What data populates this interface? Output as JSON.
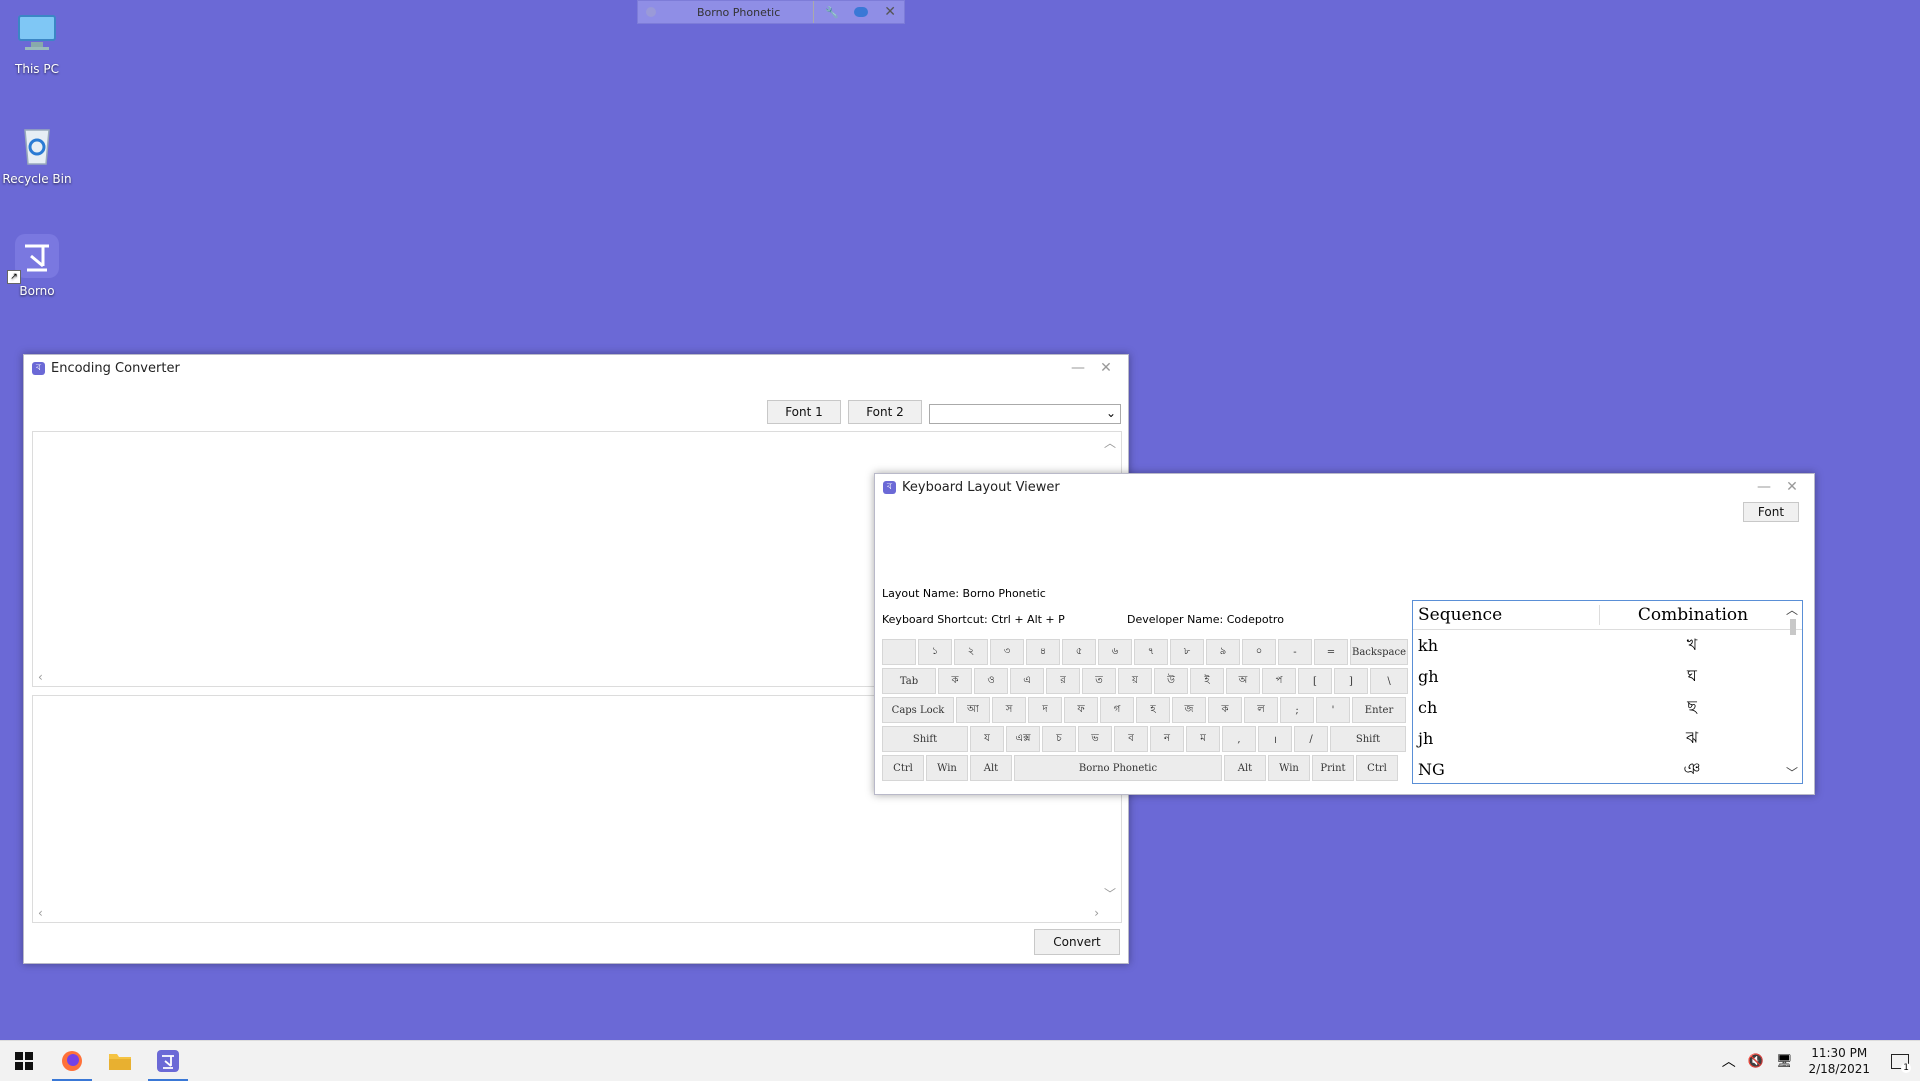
{
  "desktop": {
    "icons": [
      {
        "label": "This PC"
      },
      {
        "label": "Recycle Bin"
      },
      {
        "label": "Borno"
      }
    ]
  },
  "langbar": {
    "layout_name": "Borno Phonetic"
  },
  "encoding_converter": {
    "title": "Encoding Converter",
    "font1_label": "Font 1",
    "font2_label": "Font 2",
    "select_value": "",
    "convert_label": "Convert"
  },
  "keyboard_viewer": {
    "title": "Keyboard Layout Viewer",
    "font_button": "Font",
    "layout_name": "Layout Name: Borno Phonetic",
    "shortcut": "Keyboard Shortcut: Ctrl + Alt + P",
    "developer": "Developer Name: Codepotro",
    "keys": {
      "row1": [
        "",
        "১",
        "২",
        "৩",
        "৪",
        "৫",
        "৬",
        "৭",
        "৮",
        "৯",
        "০",
        "-",
        "=",
        "Backspace"
      ],
      "row2": [
        "Tab",
        "ক",
        "ও",
        "এ",
        "র",
        "ত",
        "য়",
        "উ",
        "ই",
        "অ",
        "প",
        "[",
        "]",
        "\\"
      ],
      "row3": [
        "Caps Lock",
        "আ",
        "স",
        "দ",
        "ফ",
        "গ",
        "হ",
        "জ",
        "ক",
        "ল",
        ";",
        "'",
        "Enter"
      ],
      "row4": [
        "Shift",
        "য",
        "এক্স",
        "চ",
        "ভ",
        "ব",
        "ন",
        "ম",
        ",",
        "।",
        "/",
        "Shift"
      ],
      "row5": [
        "Ctrl",
        "Win",
        "Alt",
        "Borno Phonetic",
        "Alt",
        "Win",
        "Print",
        "Ctrl"
      ]
    },
    "table": {
      "headers": [
        "Sequence",
        "Combination"
      ],
      "rows": [
        [
          "kh",
          "খ"
        ],
        [
          "gh",
          "ঘ"
        ],
        [
          "ch",
          "ছ"
        ],
        [
          "jh",
          "ঝ"
        ],
        [
          "NG",
          "ঞ"
        ]
      ]
    }
  },
  "taskbar": {
    "time": "11:30 PM",
    "date": "2/18/2021",
    "notification_count": "1"
  }
}
